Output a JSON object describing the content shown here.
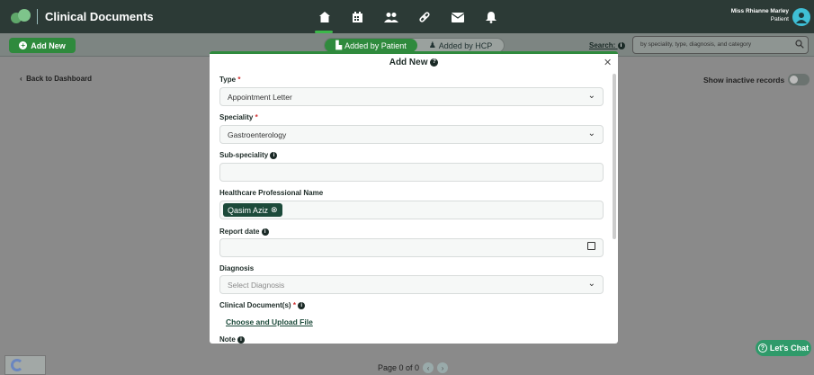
{
  "header": {
    "app_title": "Clinical Documents",
    "user_name": "Miss Rhianne Marley",
    "user_role": "Patient",
    "nav_icons": [
      "home-icon",
      "calendar-icon",
      "people-icon",
      "link-icon",
      "mail-icon",
      "bell-icon"
    ]
  },
  "toolbar": {
    "add_new_label": "Add New",
    "tab_patient": "Added by Patient",
    "tab_hcp": "Added by HCP",
    "search_label": "Search:",
    "search_placeholder": "by speciality, type, diagnosis, and category"
  },
  "page": {
    "back_label": "Back to Dashboard",
    "inactive_label": "Show inactive records",
    "pager_text": "Page 0 of 0",
    "chat_label": "Let's Chat"
  },
  "modal": {
    "title": "Add New",
    "type_label": "Type",
    "type_value": "Appointment Letter",
    "speciality_label": "Speciality",
    "speciality_value": "Gastroenterology",
    "subspeciality_label": "Sub-speciality",
    "hcp_label": "Healthcare Professional Name",
    "hcp_chip": "Qasim Aziz",
    "report_date_label": "Report date",
    "diagnosis_label": "Diagnosis",
    "diagnosis_placeholder": "Select Diagnosis",
    "clinical_docs_label": "Clinical Document(s)",
    "upload_label": "Choose and Upload File",
    "note_label": "Note"
  },
  "colors": {
    "brand_green": "#2f8a3d",
    "header_dark": "#2c3a36",
    "chip_dark": "#1c4a3a"
  }
}
